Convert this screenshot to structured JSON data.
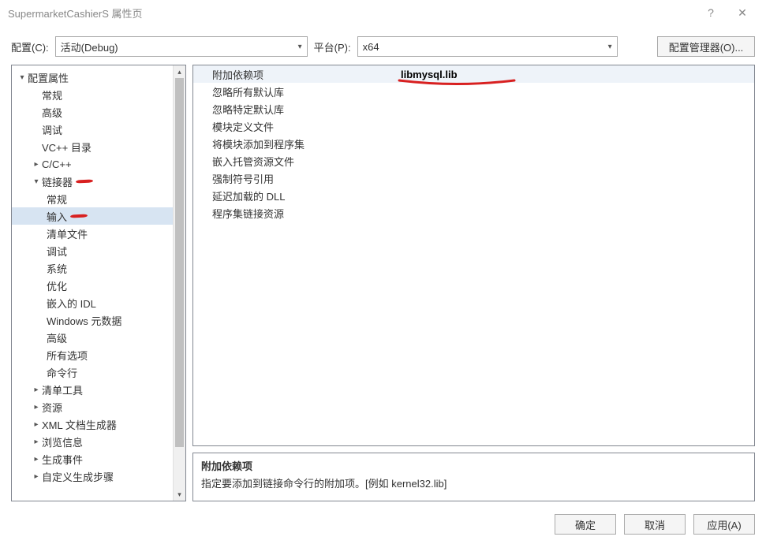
{
  "titlebar": {
    "title": "SupermarketCashierS 属性页",
    "help": "?",
    "close": "✕"
  },
  "topbar": {
    "config_label": "配置(C):",
    "config_value": "活动(Debug)",
    "platform_label": "平台(P):",
    "platform_value": "x64",
    "config_mgr": "配置管理器(O)..."
  },
  "tree": {
    "root": "配置属性",
    "items1": [
      "常规",
      "高级",
      "调试",
      "VC++ 目录"
    ],
    "cpp": "C/C++",
    "linker": "链接器",
    "linker_children": [
      "常规",
      "输入",
      "清单文件",
      "调试",
      "系统",
      "优化",
      "嵌入的 IDL",
      "Windows 元数据",
      "高级",
      "所有选项",
      "命令行"
    ],
    "rest": [
      "清单工具",
      "资源",
      "XML 文档生成器",
      "浏览信息",
      "生成事件",
      "自定义生成步骤"
    ]
  },
  "grid": {
    "rows": [
      {
        "label": "附加依赖项",
        "value": "libmysql.lib"
      },
      {
        "label": "忽略所有默认库",
        "value": ""
      },
      {
        "label": "忽略特定默认库",
        "value": ""
      },
      {
        "label": "模块定义文件",
        "value": ""
      },
      {
        "label": "将模块添加到程序集",
        "value": ""
      },
      {
        "label": "嵌入托管资源文件",
        "value": ""
      },
      {
        "label": "强制符号引用",
        "value": ""
      },
      {
        "label": "延迟加载的 DLL",
        "value": ""
      },
      {
        "label": "程序集链接资源",
        "value": ""
      }
    ]
  },
  "desc": {
    "title": "附加依赖项",
    "text": "指定要添加到链接命令行的附加项。[例如 kernel32.lib]"
  },
  "buttons": {
    "ok": "确定",
    "cancel": "取消",
    "apply": "应用(A)"
  }
}
